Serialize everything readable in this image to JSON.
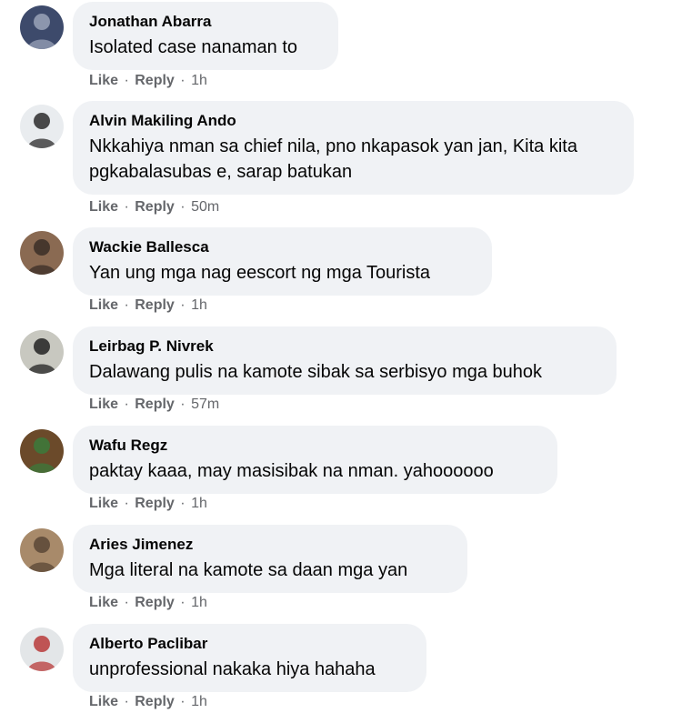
{
  "comments": [
    {
      "author": "Jonathan Abarra",
      "text": "Isolated case nanaman to",
      "time": "1h",
      "avatar_colors": [
        "#3d4a6b",
        "#9aa3b8"
      ]
    },
    {
      "author": "Alvin Makiling Ando",
      "text": "Nkkahiya nman sa chief nila, pno nkapasok yan jan, Kita kita pgkabalasubas e, sarap batukan",
      "time": "50m",
      "avatar_colors": [
        "#e9ecef",
        "#2b2b2b"
      ]
    },
    {
      "author": "Wackie Ballesca",
      "text": "Yan ung mga nag eescort ng mga Tourista",
      "time": "1h",
      "avatar_colors": [
        "#8a6a52",
        "#3a2e27"
      ]
    },
    {
      "author": "Leirbag P. Nivrek",
      "text": "Dalawang pulis na kamote sibak sa serbisyo mga buhok",
      "time": "57m",
      "avatar_colors": [
        "#c8c8c0",
        "#222222"
      ]
    },
    {
      "author": "Wafu Regz",
      "text": "paktay kaaa, may masisibak na nman. yahoooooo",
      "time": "1h",
      "avatar_colors": [
        "#6b4a2a",
        "#3b7a3b"
      ]
    },
    {
      "author": "Aries Jimenez",
      "text": "Mga literal na kamote sa daan mga yan",
      "time": "1h",
      "avatar_colors": [
        "#a88a6a",
        "#5a4636"
      ]
    },
    {
      "author": "Alberto Paclibar",
      "text": "unprofessional nakaka hiya hahaha",
      "time": "1h",
      "avatar_colors": [
        "#e3e6e8",
        "#b83a3a"
      ]
    }
  ],
  "actions": {
    "like": "Like",
    "reply": "Reply",
    "separator": "·"
  }
}
